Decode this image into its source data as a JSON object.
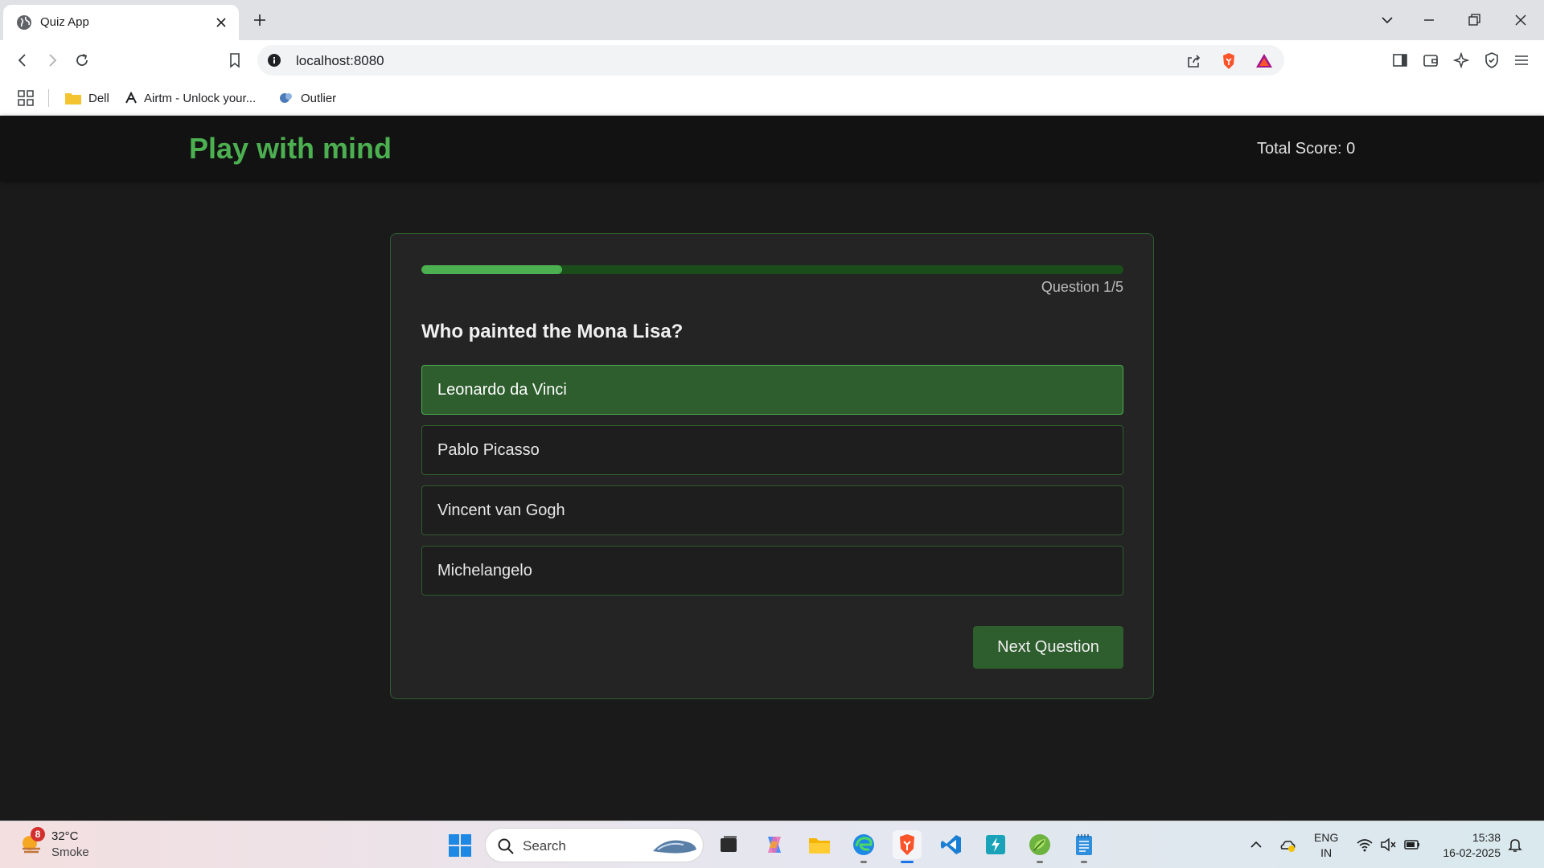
{
  "browser": {
    "tab_title": "Quiz App",
    "url": "localhost:8080",
    "bookmarks": [
      "Dell",
      "Airtm - Unlock your...",
      "Outlier"
    ]
  },
  "app": {
    "title": "Play with mind",
    "total_score": "Total Score: 0",
    "progress": {
      "current": 1,
      "total": 5,
      "fraction": 0.2
    },
    "question_counter": "Question 1/5",
    "question": "Who painted the Mona Lisa?",
    "options": [
      "Leonardo da Vinci",
      "Pablo Picasso",
      "Vincent van Gogh",
      "Michelangelo"
    ],
    "selected_option": "Leonardo da Vinci",
    "next_button": "Next Question",
    "accent_color": "#4caf50"
  },
  "taskbar": {
    "weather_badge": "8",
    "temperature": "32°C",
    "weather": "Smoke",
    "search_label": "Search",
    "lang_top": "ENG",
    "lang_bottom": "IN",
    "time": "15:38",
    "date": "16-02-2025"
  }
}
